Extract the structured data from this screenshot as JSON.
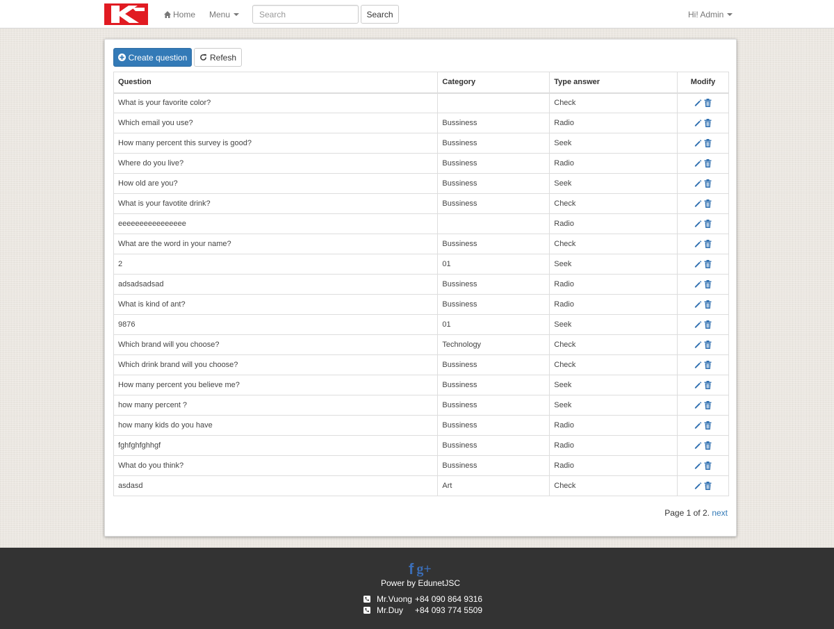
{
  "nav": {
    "home": "Home",
    "menu": "Menu",
    "search_placeholder": "Search",
    "search_button": "Search",
    "user": "Hi! Admin"
  },
  "toolbar": {
    "create": "Create question",
    "refresh": "Refesh"
  },
  "table": {
    "headers": [
      "Question",
      "Category",
      "Type answer",
      "Modify"
    ],
    "rows": [
      {
        "question": "What is your favorite color?",
        "category": "",
        "type": "Check"
      },
      {
        "question": "Which email you use?",
        "category": "Bussiness",
        "type": "Radio"
      },
      {
        "question": "How many percent this survey is good?",
        "category": "Bussiness",
        "type": "Seek"
      },
      {
        "question": "Where do you live?",
        "category": "Bussiness",
        "type": "Radio"
      },
      {
        "question": "How old are you?",
        "category": "Bussiness",
        "type": "Seek"
      },
      {
        "question": "What is your favotite drink?",
        "category": "Bussiness",
        "type": "Check"
      },
      {
        "question": "eeeeeeeeeeeeeeee",
        "category": "",
        "type": "Radio"
      },
      {
        "question": "What are the word in your name?",
        "category": "Bussiness",
        "type": "Check"
      },
      {
        "question": "2",
        "category": "01",
        "type": "Seek"
      },
      {
        "question": "adsadsadsad",
        "category": "Bussiness",
        "type": "Radio"
      },
      {
        "question": "What is kind of ant?",
        "category": "Bussiness",
        "type": "Radio"
      },
      {
        "question": "9876",
        "category": "01",
        "type": "Seek"
      },
      {
        "question": "Which brand will you choose?",
        "category": "Technology",
        "type": "Check"
      },
      {
        "question": "Which drink brand will you choose?",
        "category": "Bussiness",
        "type": "Check"
      },
      {
        "question": "How many percent you believe me?",
        "category": "Bussiness",
        "type": "Seek"
      },
      {
        "question": "how many percent ?",
        "category": "Bussiness",
        "type": "Seek"
      },
      {
        "question": "how many kids do you have",
        "category": "Bussiness",
        "type": "Radio"
      },
      {
        "question": "fghfghfghhgf",
        "category": "Bussiness",
        "type": "Radio"
      },
      {
        "question": "What do you think?",
        "category": "Bussiness",
        "type": "Radio"
      },
      {
        "question": "asdasd",
        "category": "Art",
        "type": "Check"
      }
    ]
  },
  "pager": {
    "text": "Page 1 of 2.",
    "next": "next"
  },
  "footer": {
    "social_facebook": "f",
    "social_google": "g+",
    "power": "Power by EdunetJSC",
    "contacts": [
      {
        "name": "Mr.Vuong",
        "phone": "+84 090 864 9316"
      },
      {
        "name": "Mr.Duy",
        "phone": "+84 093 774 5509"
      }
    ]
  },
  "colors": {
    "primary": "#337ab7",
    "logo_red": "#e11b22",
    "footer_bg": "#333333",
    "icon_blue": "#2f6fb0"
  }
}
